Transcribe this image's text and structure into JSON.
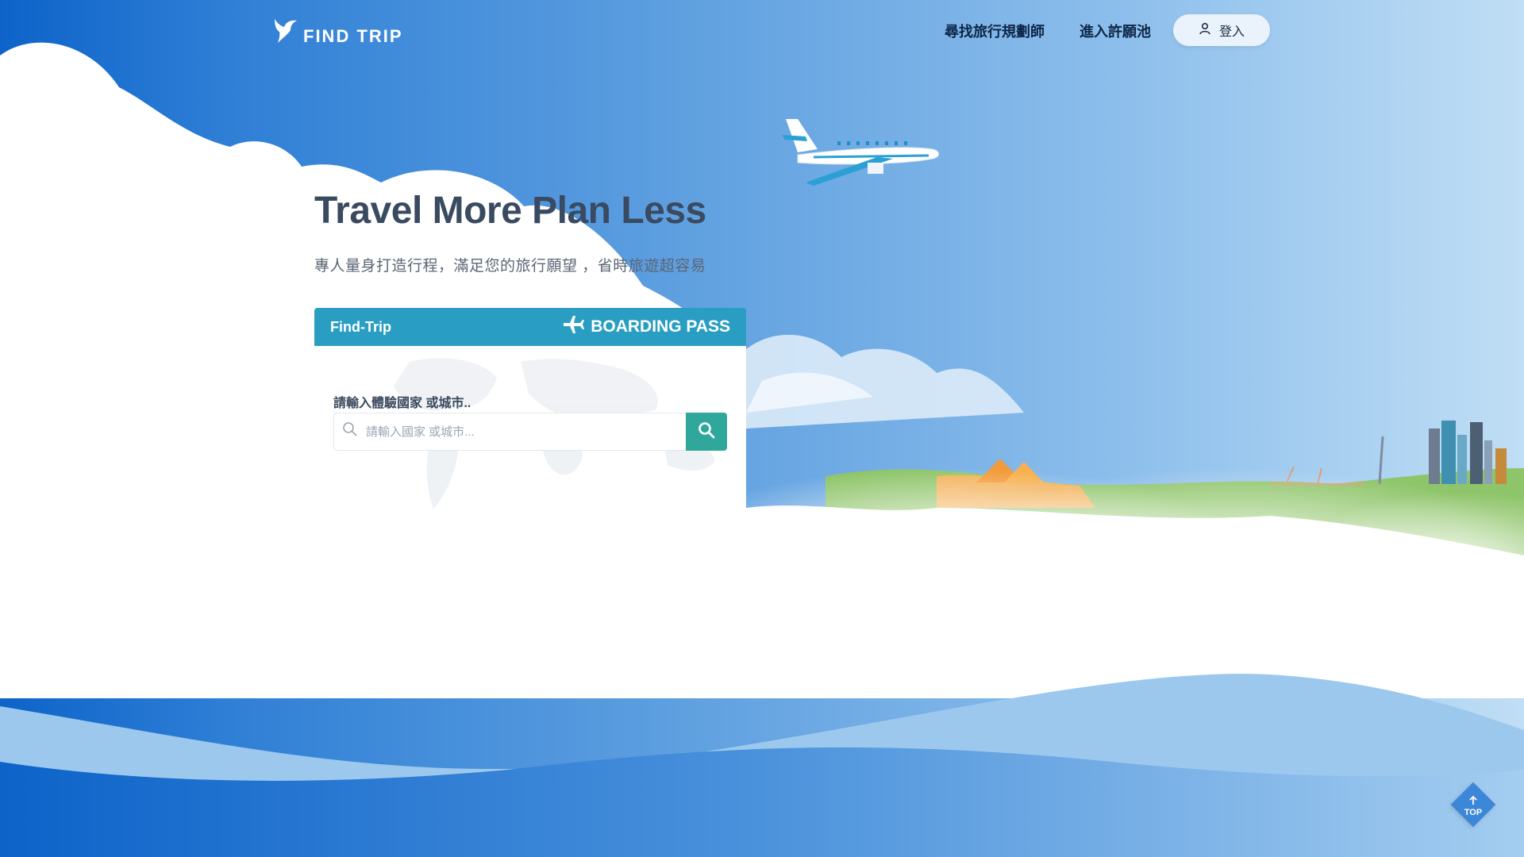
{
  "brand": {
    "logo_text": "FIND TRIP"
  },
  "nav": {
    "planner": "尋找旅行規劃師",
    "wishpool": "進入許願池",
    "login": "登入"
  },
  "hero": {
    "title": "Travel More Plan Less",
    "subtitle": "專人量身打造行程，滿足您的旅行願望 ，省時旅遊超容易"
  },
  "boarding": {
    "brand": "Find-Trip",
    "pass_label": "BOARDING PASS",
    "field_label": "請輸入體驗國家 或城市..",
    "search_placeholder": "請輸入國家 或城市..."
  },
  "scroll_top": {
    "label": "TOP"
  },
  "colors": {
    "card_header": "#2a9ec2",
    "search_button": "#2fa79a",
    "top_button": "#3d87d8",
    "title_text": "#3a4a61"
  },
  "icons": {
    "logo": "bird-icon",
    "login": "user-icon",
    "pass": "airplane-icon",
    "search_inline": "magnifier-icon",
    "search_button": "search-icon",
    "top": "arrow-up-icon"
  }
}
